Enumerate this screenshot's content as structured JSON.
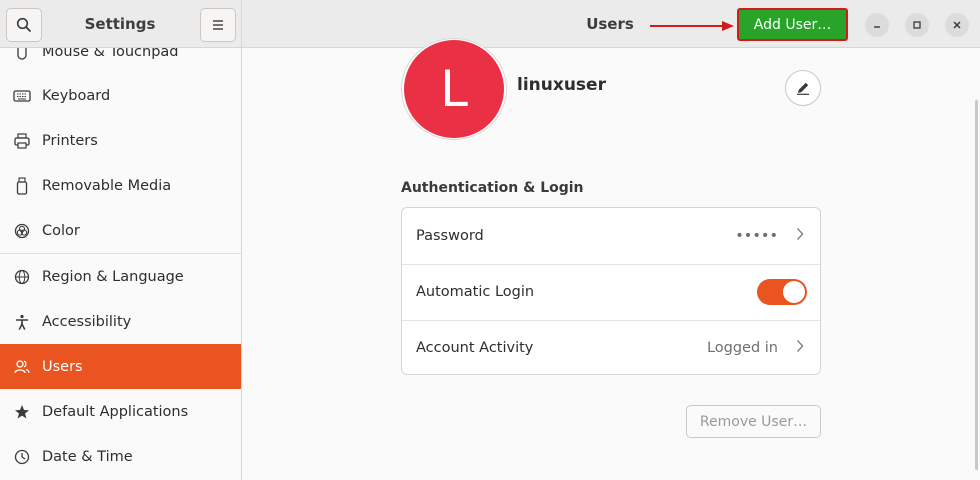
{
  "header": {
    "sidebar_title": "Settings",
    "main_title": "Users",
    "add_user_label": "Add User…",
    "highlight_color": "#d21c1c",
    "add_user_color": "#28a428"
  },
  "sidebar": {
    "items": [
      {
        "label": "Mouse & Touchpad",
        "icon": "mouse-icon"
      },
      {
        "label": "Keyboard",
        "icon": "keyboard-icon"
      },
      {
        "label": "Printers",
        "icon": "printer-icon"
      },
      {
        "label": "Removable Media",
        "icon": "removable-media-icon"
      },
      {
        "label": "Color",
        "icon": "color-icon"
      },
      {
        "label": "Region & Language",
        "icon": "globe-icon"
      },
      {
        "label": "Accessibility",
        "icon": "accessibility-icon"
      },
      {
        "label": "Users",
        "icon": "users-icon",
        "active": true
      },
      {
        "label": "Default Applications",
        "icon": "star-icon"
      },
      {
        "label": "Date & Time",
        "icon": "clock-icon"
      }
    ],
    "accent_color": "#e95420"
  },
  "user": {
    "avatar_letter": "L",
    "avatar_color": "#ea3045",
    "name": "linuxuser"
  },
  "auth": {
    "section_title": "Authentication & Login",
    "password_label": "Password",
    "password_value": "•••••",
    "automatic_login_label": "Automatic Login",
    "automatic_login_enabled": true,
    "account_activity_label": "Account Activity",
    "account_activity_value": "Logged in"
  },
  "remove_user_label": "Remove User…"
}
